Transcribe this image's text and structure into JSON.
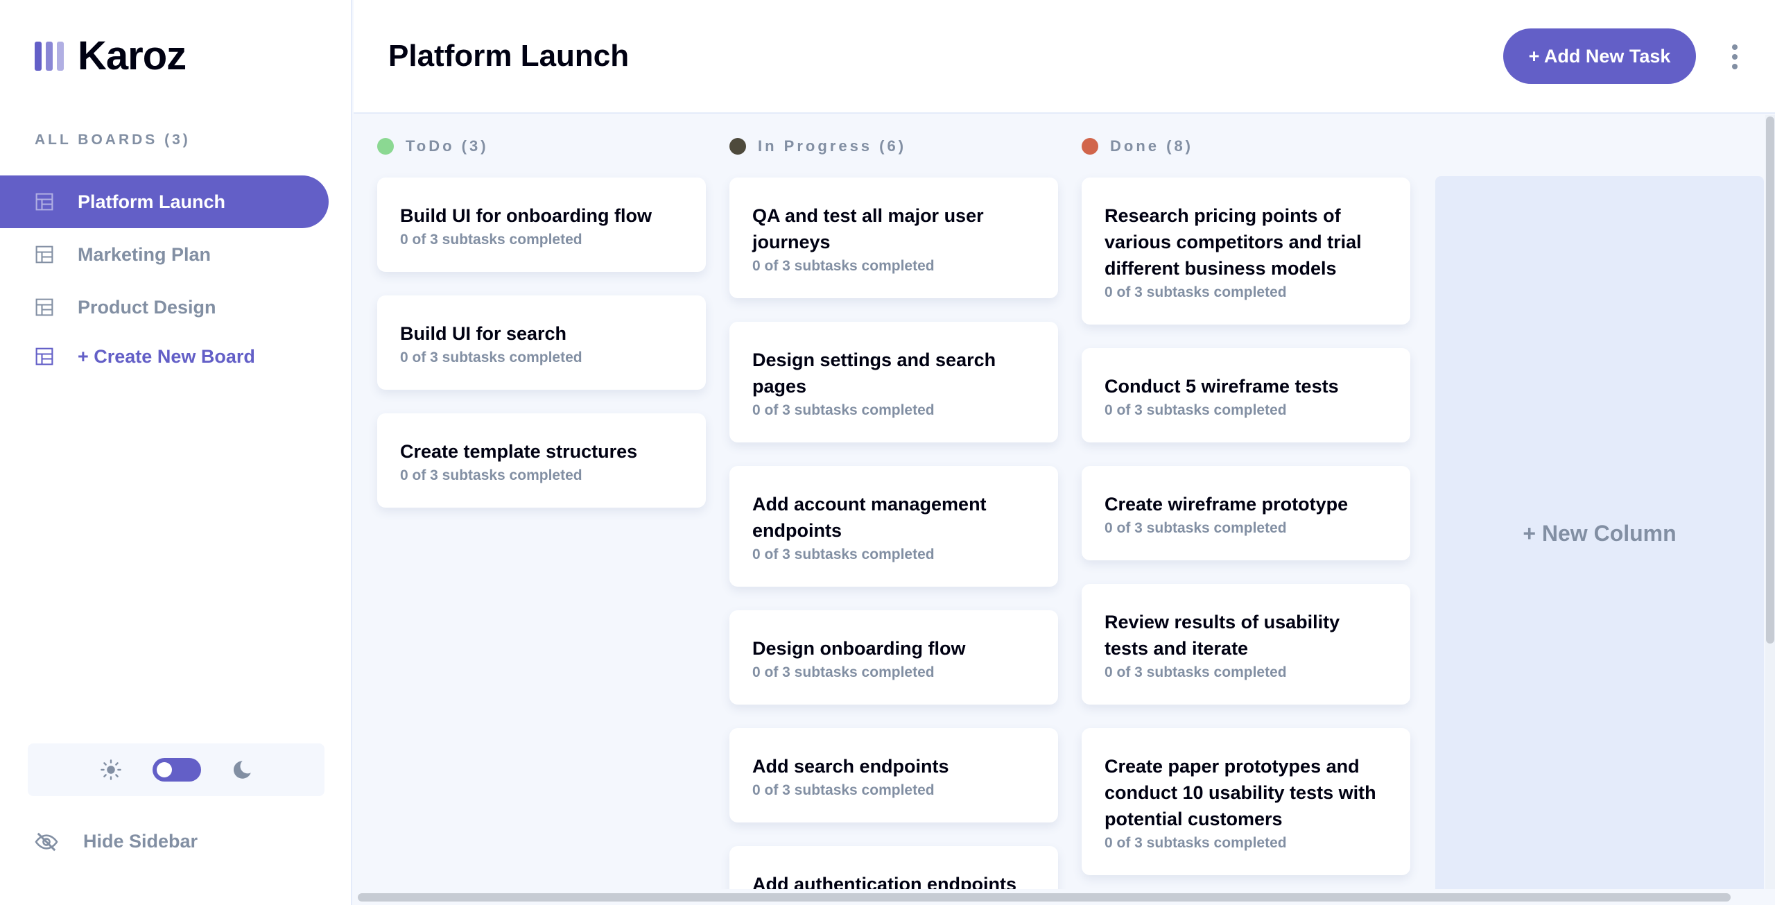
{
  "app": {
    "name": "Karoz"
  },
  "sidebar": {
    "heading": "ALL BOARDS (3)",
    "boards": [
      {
        "label": "Platform Launch",
        "active": true
      },
      {
        "label": "Marketing Plan",
        "active": false
      },
      {
        "label": "Product Design",
        "active": false
      }
    ],
    "create_label": "+ Create New Board",
    "hide_label": "Hide Sidebar",
    "theme": {
      "mode": "light"
    }
  },
  "header": {
    "title": "Platform Launch",
    "add_task_label": "+ Add New Task"
  },
  "columns": [
    {
      "name": "ToDo (3)",
      "color": "#8bd892",
      "tasks": [
        {
          "title": "Build UI for onboarding flow",
          "subtasks": "0 of 3 subtasks completed"
        },
        {
          "title": "Build UI for search",
          "subtasks": "0 of 3 subtasks completed"
        },
        {
          "title": "Create template structures",
          "subtasks": "0 of 3 subtasks completed"
        }
      ]
    },
    {
      "name": "In Progress (6)",
      "color": "#4e4a3c",
      "tasks": [
        {
          "title": "QA and test all major user journeys",
          "subtasks": "0 of 3 subtasks completed"
        },
        {
          "title": "Design settings and search pages",
          "subtasks": "0 of 3 subtasks completed"
        },
        {
          "title": "Add account management endpoints",
          "subtasks": "0 of 3 subtasks completed"
        },
        {
          "title": "Design onboarding flow",
          "subtasks": "0 of 3 subtasks completed"
        },
        {
          "title": "Add search endpoints",
          "subtasks": "0 of 3 subtasks completed"
        },
        {
          "title": "Add authentication endpoints",
          "subtasks": ""
        }
      ]
    },
    {
      "name": "Done (8)",
      "color": "#d1654b",
      "tasks": [
        {
          "title": "Research pricing points of various competitors and trial different business models",
          "subtasks": "0 of 3 subtasks completed"
        },
        {
          "title": "Conduct 5 wireframe tests",
          "subtasks": "0 of 3 subtasks completed"
        },
        {
          "title": "Create wireframe prototype",
          "subtasks": "0 of 3 subtasks completed"
        },
        {
          "title": "Review results of usability tests and iterate",
          "subtasks": "0 of 3 subtasks completed"
        },
        {
          "title": "Create paper prototypes and conduct 10 usability tests with potential customers",
          "subtasks": "0 of 3 subtasks completed"
        }
      ]
    }
  ],
  "new_column_label": "+ New Column",
  "colors": {
    "accent": "#635fc7",
    "muted": "#828fa3",
    "background": "#f4f7fd",
    "new_column_bg": "#e4ebfa"
  }
}
